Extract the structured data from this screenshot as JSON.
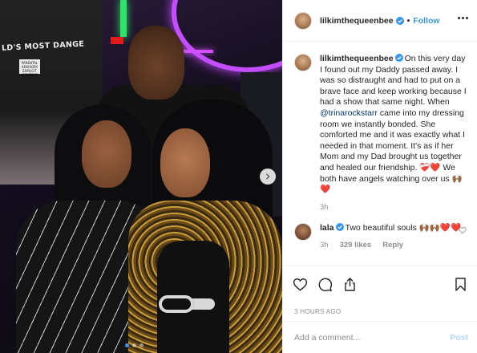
{
  "photo": {
    "shirt_text": "LD'S MOST DANGE",
    "shirt_tag": "PARENTAL ADVISORY EXPLICIT CONTENT",
    "carousel": {
      "total": 3,
      "active_index": 0
    }
  },
  "header": {
    "username": "lilkimthequeenbee",
    "separator": "•",
    "follow_label": "Follow"
  },
  "caption": {
    "username": "lilkimthequeenbee",
    "text_before_mention": "On this very day I found out my Daddy passed away. I was so distraught and had to put on a brave face and keep working because I had a show that same night. When ",
    "mention": "@trinarockstarr",
    "text_after_mention": " came into my dressing room we instantly bonded. She comforted me and it was exactly what I needed in that moment. It's as if her Mom and my Dad brought us together and healed our friendship. ❤️‍🩹❤️ We both have angels watching over us 🙌🏾❤️",
    "time": "3h"
  },
  "comment": {
    "username": "lala",
    "text": "Two beautiful souls 🙌🏾🙌🏾❤️❤️",
    "time": "3h",
    "likes": "329 likes",
    "reply_label": "Reply"
  },
  "post_timestamp": "3 HOURS AGO",
  "add_comment": {
    "placeholder": "Add a comment...",
    "post_label": "Post"
  },
  "colors": {
    "accent": "#3897f0",
    "verified": "#3897f0",
    "post_disabled": "#b3d8fb",
    "meta": "#8e8e8e"
  }
}
